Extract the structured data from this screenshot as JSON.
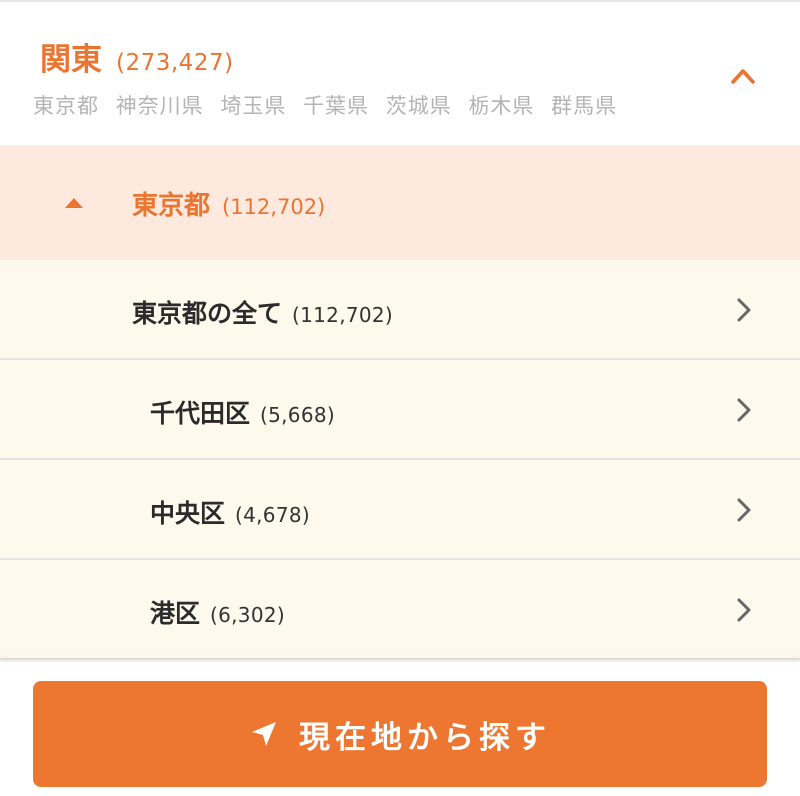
{
  "colors": {
    "accent": "#ea7530",
    "button": "#ed7630",
    "pref_header_bg": "#fde9dd",
    "list_bg": "#fdf9ec",
    "muted_text": "#b4b4b4",
    "chevron": "#666666"
  },
  "region": {
    "name": "関東",
    "count": "(273,427)",
    "prefectures": [
      "東京都",
      "神奈川県",
      "埼玉県",
      "千葉県",
      "茨城県",
      "栃木県",
      "群馬県"
    ],
    "toggle_icon": "chevron-up-icon"
  },
  "prefecture": {
    "name": "東京都",
    "count": "(112,702)",
    "toggle_icon": "caret-up-icon"
  },
  "cities": [
    {
      "name": "東京都の全て",
      "count": "(112,702)",
      "level": 0
    },
    {
      "name": "千代田区",
      "count": "(5,668)",
      "level": 1
    },
    {
      "name": "中央区",
      "count": "(4,678)",
      "level": 1
    },
    {
      "name": "港区",
      "count": "(6,302)",
      "level": 1
    }
  ],
  "row_icon": "chevron-right-icon",
  "locate_button": {
    "label": "現在地から探す",
    "icon": "location-arrow-icon"
  }
}
